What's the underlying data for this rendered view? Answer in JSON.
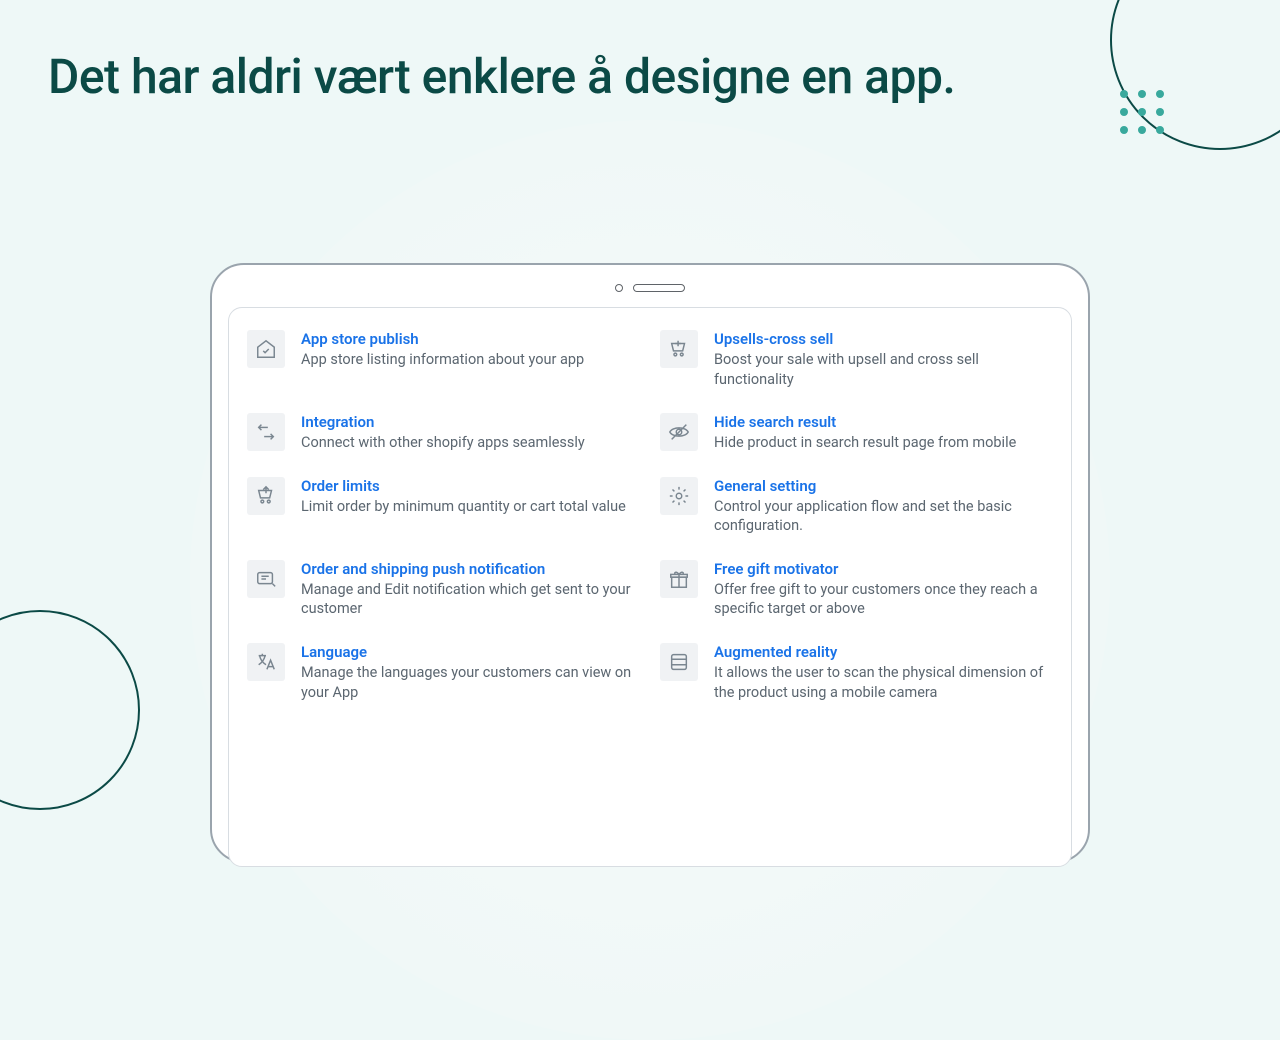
{
  "hero": {
    "title": "Det har aldri vært enklere å designe en app."
  },
  "features": {
    "left": [
      {
        "title": "App store publish",
        "desc": "App store listing information about your app"
      },
      {
        "title": "Integration",
        "desc": "Connect with other shopify apps seamlessly"
      },
      {
        "title": "Order limits",
        "desc": "Limit order by minimum quantity or cart total value"
      },
      {
        "title": "Order and shipping push notification",
        "desc": "Manage and Edit notification which get sent to your customer"
      },
      {
        "title": "Language",
        "desc": "Manage the languages your customers can view on your App"
      }
    ],
    "right": [
      {
        "title": "Upsells-cross sell",
        "desc": "Boost your sale with upsell and cross sell functionality"
      },
      {
        "title": "Hide search result",
        "desc": "Hide product in search result page from mobile"
      },
      {
        "title": "General setting",
        "desc": "Control your application flow and set the basic configuration."
      },
      {
        "title": "Free gift motivator",
        "desc": "Offer free gift to your customers once they reach a specific target or above"
      },
      {
        "title": "Augmented reality",
        "desc": "It allows the user to scan the physical dimension of the product using a mobile camera"
      }
    ]
  }
}
